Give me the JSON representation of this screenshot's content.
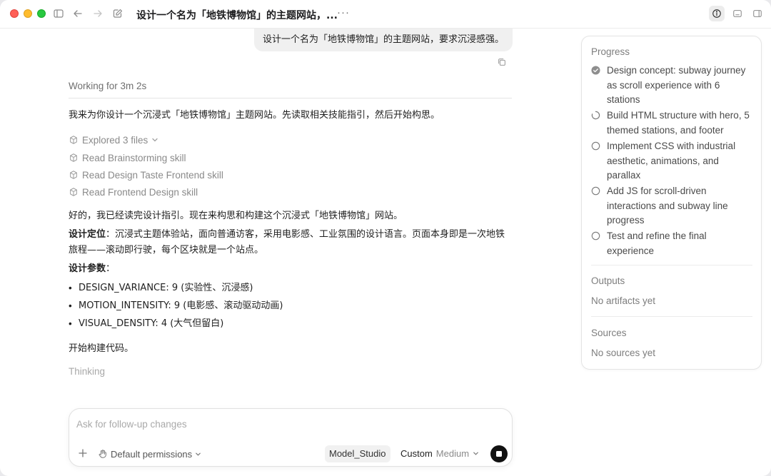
{
  "titlebar": {
    "title": "设计一个名为「地铁博物馆」的主题网站，...",
    "more": "···"
  },
  "chat": {
    "user_message": "设计一个名为「地铁博物馆」的主题网站，要求沉浸感强。",
    "working_label": "Working for 3m 2s",
    "intro": "我来为你设计一个沉浸式「地铁博物馆」主题网站。先读取相关技能指引，然后开始构思。",
    "tools": {
      "explored": "Explored 3 files",
      "items": [
        "Read Brainstorming skill",
        "Read Design Taste Frontend skill",
        "Read Frontend Design skill"
      ]
    },
    "after_read": "好的，我已经读完设计指引。现在来构思和构建这个沉浸式「地铁博物馆」网站。",
    "positioning_label": "设计定位",
    "positioning_text": "：沉浸式主题体验站，面向普通访客，采用电影感、工业氛围的设计语言。页面本身即是一次地铁旅程——滚动即行驶，每个区块就是一个站点。",
    "params_label": "设计参数",
    "params_colon": "：",
    "params": [
      "DESIGN_VARIANCE: 9 (实验性、沉浸感)",
      "MOTION_INTENSITY: 9 (电影感、滚动驱动动画)",
      "VISUAL_DENSITY: 4 (大气但留白)"
    ],
    "bullet": "•",
    "start": "开始构建代码。",
    "thinking": "Thinking"
  },
  "composer": {
    "placeholder": "Ask for follow-up changes",
    "permissions": "Default permissions",
    "model": "Model_Studio",
    "mode": "Custom",
    "level": "Medium"
  },
  "panel": {
    "progress_title": "Progress",
    "steps": [
      {
        "text": "Design concept: subway journey as scroll experience with 6 stations",
        "status": "done"
      },
      {
        "text": "Build HTML structure with hero, 5 themed stations, and footer",
        "status": "in-progress"
      },
      {
        "text": "Implement CSS with industrial aesthetic, animations, and parallax",
        "status": "pending"
      },
      {
        "text": "Add JS for scroll-driven interactions and subway line progress",
        "status": "pending"
      },
      {
        "text": "Test and refine the final experience",
        "status": "pending"
      }
    ],
    "outputs_title": "Outputs",
    "outputs_empty": "No artifacts yet",
    "sources_title": "Sources",
    "sources_empty": "No sources yet"
  },
  "icons": {
    "sidebar_toggle": "sidebar-icon",
    "back": "arrow-left-icon",
    "forward": "arrow-right-icon",
    "new_chat": "compose-icon",
    "info": "info-icon",
    "terminal": "terminal-icon",
    "panel_right": "panel-right-icon",
    "copy": "copy-icon",
    "tool": "cube-icon",
    "plus": "plus-icon",
    "hand": "hand-icon",
    "stop": "stop-icon"
  },
  "colors": {
    "traffic_red": "#ff5f57",
    "traffic_yellow": "#febc2e",
    "traffic_green": "#28c840",
    "stop_button": "#111111"
  }
}
